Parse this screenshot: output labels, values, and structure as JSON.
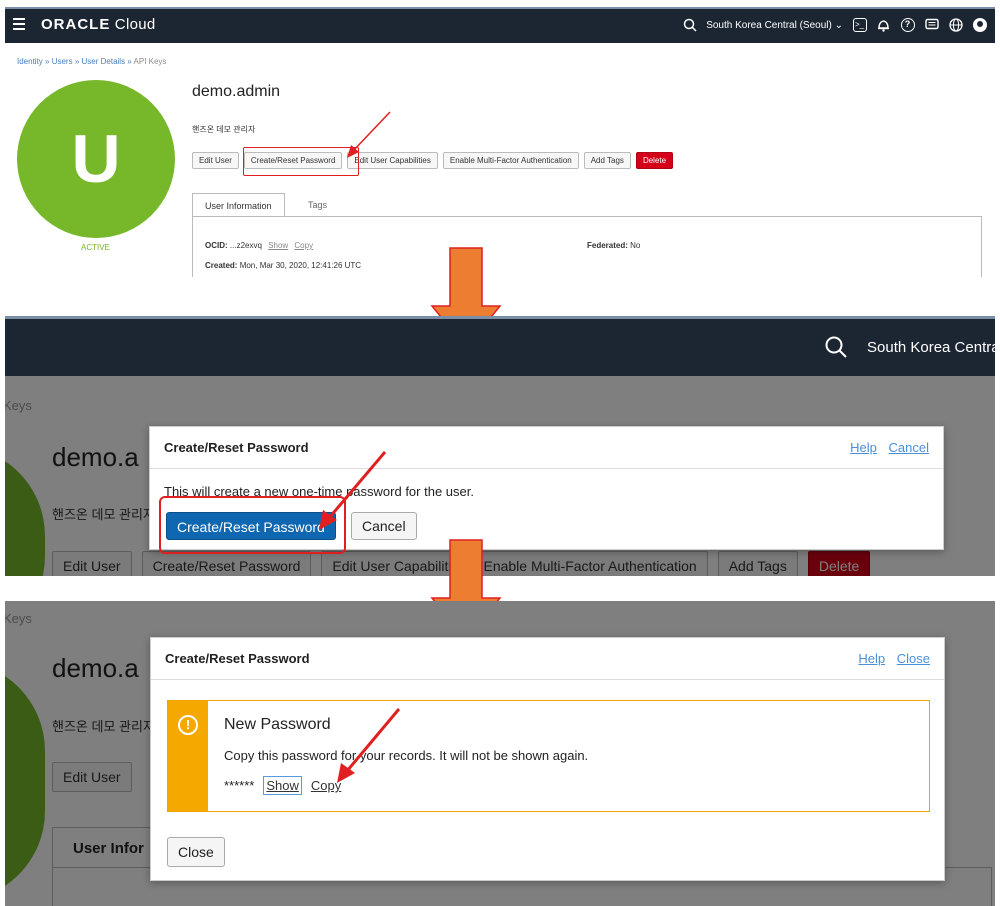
{
  "panel1": {
    "brand": {
      "bold": "ORACLE",
      "rest": " Cloud"
    },
    "region": "South Korea Central (Seoul)",
    "breadcrumb": [
      "Identity",
      "Users",
      "User Details",
      "API Keys"
    ],
    "avatar_letter": "U",
    "status": "ACTIVE",
    "user_name": "demo.admin",
    "user_desc": "핸즈온 데모 관리자",
    "buttons": [
      "Edit User",
      "Create/Reset Password",
      "Edit User Capabilities",
      "Enable Multi-Factor Authentication",
      "Add Tags",
      "Delete"
    ],
    "tabs": [
      "User Information",
      "Tags"
    ],
    "ocid_label": "OCID:",
    "ocid_value": "...z2exvq",
    "ocid_show": "Show",
    "ocid_copy": "Copy",
    "federated_label": "Federated:",
    "federated_value": "No",
    "created_label": "Created:",
    "created_value": "Mon, Mar 30, 2020, 12:41:26 UTC"
  },
  "panel2": {
    "region": "South Korea Centra",
    "crumb_tail": "Keys",
    "user_name": "demo.a",
    "user_desc": "핸즈온 데모 관리자",
    "buttons": [
      "Edit User",
      "Create/Reset Password",
      "Edit User Capabiliti",
      "Enable Multi-Factor Authentication",
      "Add Tags",
      "Delete"
    ],
    "dialog": {
      "title": "Create/Reset Password",
      "help": "Help",
      "cancel_link": "Cancel",
      "message": "This will create a new one-time password for the user.",
      "primary": "Create/Reset Password",
      "secondary": "Cancel"
    }
  },
  "panel3": {
    "crumb_tail": "Keys",
    "user_name": "demo.a",
    "user_desc": "핸즈온 데모 관리자",
    "edit_user": "Edit User",
    "user_info_tab": "User Infor",
    "dialog": {
      "title": "Create/Reset Password",
      "help": "Help",
      "close_link": "Close",
      "alert_title": "New Password",
      "alert_body": "Copy this password for your records. It will not be shown again.",
      "masked": "******",
      "show": "Show",
      "copy": "Copy",
      "close_button": "Close"
    }
  },
  "colors": {
    "topbar": "#1c2532",
    "avatar_green": "#76b82a",
    "primary_blue": "#0f67b1",
    "danger_red": "#d40019",
    "warning_orange": "#f5a800",
    "annotation_arrow": "#ed7d31",
    "annotation_red": "#e02020"
  }
}
